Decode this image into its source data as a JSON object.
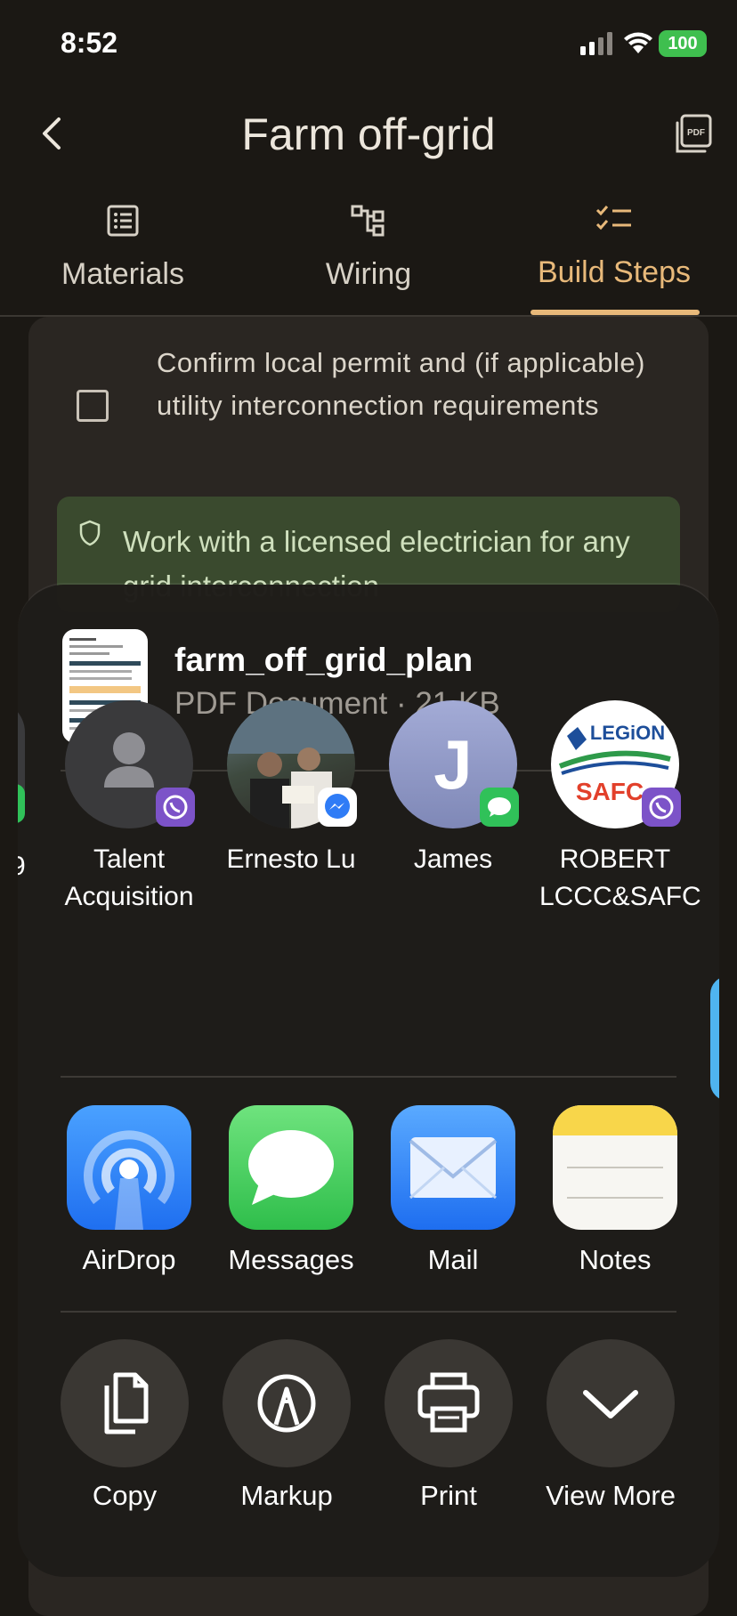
{
  "status_bar": {
    "time": "8:52",
    "battery": "100"
  },
  "header": {
    "title": "Farm off-grid"
  },
  "tabs": [
    {
      "label": "Materials",
      "icon": "list-icon"
    },
    {
      "label": "Wiring",
      "icon": "diagram-icon"
    },
    {
      "label": "Build Steps",
      "icon": "checklist-icon",
      "active": true
    }
  ],
  "content": {
    "step_text": "Confirm local permit and (if applicable) utility interconnection requirements",
    "notice_text": "Work with a licensed electrician for any grid interconnection"
  },
  "share": {
    "doc_name": "farm_off_grid_plan",
    "doc_meta": "PDF Document · 21 KB",
    "contacts": [
      {
        "name": "Talent Acquisition",
        "badge": "viber-icon"
      },
      {
        "name": "Ernesto Lu",
        "badge": "messenger-icon"
      },
      {
        "name": "James",
        "initial": "J",
        "badge": "messages-icon"
      },
      {
        "name": "ROBERT LCCC&SAFC",
        "badge": "viber-icon"
      }
    ],
    "partial_contact_char": "9",
    "apps": [
      {
        "name": "AirDrop"
      },
      {
        "name": "Messages"
      },
      {
        "name": "Mail"
      },
      {
        "name": "Notes"
      }
    ],
    "actions": [
      {
        "name": "Copy"
      },
      {
        "name": "Markup"
      },
      {
        "name": "Print"
      },
      {
        "name": "View More"
      }
    ]
  },
  "colors": {
    "accent": "#e8b97a",
    "background": "#1b1814",
    "sheet": "#1e1c19",
    "notice_bg": "#3a4a2e"
  }
}
